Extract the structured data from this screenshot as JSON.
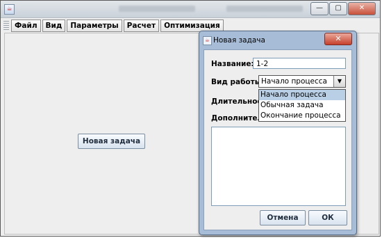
{
  "main": {
    "menus": [
      "Файл",
      "Вид",
      "Параметры",
      "Расчет",
      "Оптимизация"
    ],
    "new_task_button": "Новая задача",
    "window_controls": {
      "minimize": "—",
      "maximize": "▢",
      "close": "✕"
    }
  },
  "dialog": {
    "title": "Новая задача",
    "close": "✕",
    "name_label": "Название:",
    "name_value": "1-2",
    "work_type_label": "Вид работы:",
    "work_type_selected": "Начало процесса",
    "work_type_options": [
      "Начало процесса",
      "Обычная задача",
      "Окончание процесса"
    ],
    "duration_label": "Длительность:",
    "extra_label": "Дополнительная информация:",
    "cancel_button": "Отмена",
    "ok_button": "ОК"
  }
}
